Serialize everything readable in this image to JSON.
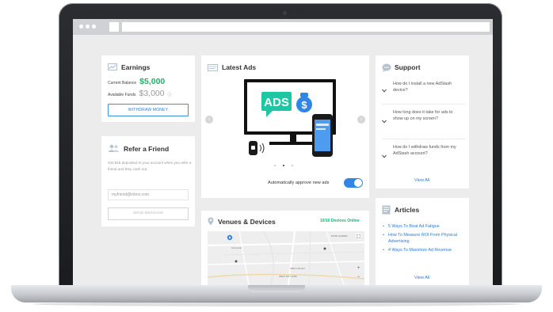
{
  "earnings": {
    "title": "Earnings",
    "current_balance_label": "Current Balance",
    "current_balance": "$5,000",
    "available_funds_label": "Available Funds",
    "available_funds": "$3,000",
    "withdraw_label": "WITHDRAW MONEY"
  },
  "refer": {
    "title": "Refer a Friend",
    "description": "Get $15 deposited in your account when you refer a friend and they cash out.",
    "email_placeholder": "myfriend@inbox.com",
    "send_label": "SEND MESSAGE"
  },
  "ads": {
    "title": "Latest Ads",
    "screen_text": "ADS",
    "approve_label": "Automatically approve new ads",
    "auto_approve": true
  },
  "support": {
    "title": "Support",
    "questions": [
      "How do I install a new AdStash device?",
      "How long does it take for ads to show up on my screen?",
      "How do I withdraw funds from my AdStash account?"
    ],
    "view_all": "View All"
  },
  "venues": {
    "title": "Venues & Devices",
    "online_status": "10/10 Devices Online",
    "map_labels": [
      "Sunnyvale",
      "WEST VALLEY",
      "WEST SAN JOSE",
      "ROSE GARDEN"
    ]
  },
  "articles": {
    "title": "Articles",
    "items": [
      "5 Ways To Beat Ad Fatigue",
      "How To Measure ROI From Physical Advertising",
      "4 Ways To Maximize Ad Revenue"
    ],
    "view_all": "View All"
  },
  "colors": {
    "accent_blue": "#2f86e7",
    "success_green": "#19b36b",
    "ads_teal": "#1fc6a4"
  }
}
